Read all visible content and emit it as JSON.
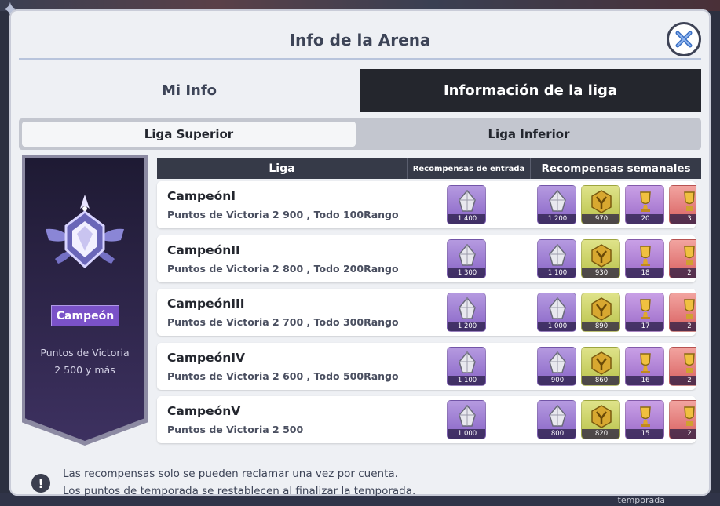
{
  "window": {
    "title": "Info de la Arena",
    "background_caption": "temporada"
  },
  "tabs": [
    {
      "label": "Mi Info",
      "active": false
    },
    {
      "label": "Información de la liga",
      "active": true
    }
  ],
  "subtabs": [
    {
      "label": "Liga Superior",
      "active": true
    },
    {
      "label": "Liga Inferior",
      "active": false
    }
  ],
  "league_card": {
    "rank": "Campeón",
    "points_label": "Puntos de Victoria",
    "points_value": "2 500 y más"
  },
  "table": {
    "headers": {
      "liga": "Liga",
      "entry": "Recompensas de entrada",
      "weekly": "Recompensas semanales"
    },
    "rows": [
      {
        "name": "CampeónI",
        "desc": "Puntos de Victoria  2 900 , Todo  100Rango",
        "entry_qty": "1 400",
        "weekly": [
          "1 200",
          "970",
          "20",
          "3"
        ]
      },
      {
        "name": "CampeónII",
        "desc": "Puntos de Victoria  2 800 , Todo  200Rango",
        "entry_qty": "1 300",
        "weekly": [
          "1 100",
          "930",
          "18",
          "2"
        ]
      },
      {
        "name": "CampeónIII",
        "desc": "Puntos de Victoria  2 700 , Todo  300Rango",
        "entry_qty": "1 200",
        "weekly": [
          "1 000",
          "890",
          "17",
          "2"
        ]
      },
      {
        "name": "CampeónIV",
        "desc": "Puntos de Victoria  2 600 , Todo  500Rango",
        "entry_qty": "1 100",
        "weekly": [
          "900",
          "860",
          "16",
          "2"
        ]
      },
      {
        "name": "CampeónV",
        "desc": "Puntos de Victoria  2 500",
        "entry_qty": "1 000",
        "weekly": [
          "800",
          "820",
          "15",
          "2"
        ]
      }
    ]
  },
  "footer": {
    "line1": "Las recompensas solo se pueden reclamar una vez por cuenta.",
    "line2": "Los puntos de temporada se restablecen al finalizar la temporada."
  },
  "icons": {
    "close": "close-icon",
    "info": "exclamation-icon",
    "entry_item": "crystal-icon",
    "weekly_items": [
      "crystal-icon",
      "medal-coin-icon",
      "trophy-icon",
      "reward-icon"
    ]
  },
  "colors": {
    "active_tab": "#24262d",
    "rank_badge": "#7a52c8",
    "item_gem": "#8864c6",
    "item_coin": "#b9c24a",
    "item_red": "#d86060"
  }
}
